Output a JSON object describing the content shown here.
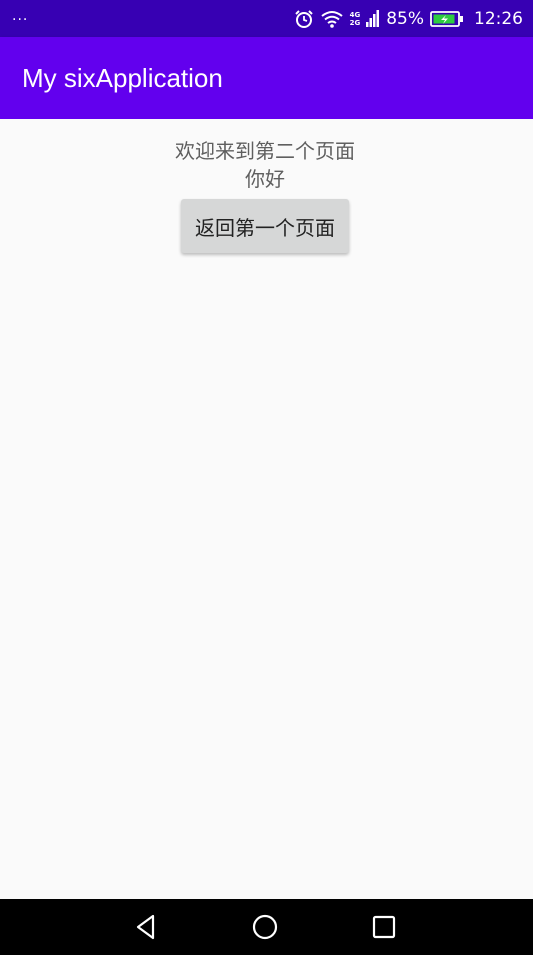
{
  "status_bar": {
    "left_text": "...",
    "network_top": "4G",
    "network_bottom": "2G",
    "battery_percent": "85%",
    "time": "12:26",
    "icons": [
      "alarm-icon",
      "wifi-icon",
      "signal-icon",
      "battery-charging-icon"
    ],
    "background": "#3700b3"
  },
  "app_bar": {
    "title": "My sixApplication",
    "background": "#6200ee"
  },
  "content": {
    "line1": "欢迎来到第二个页面",
    "line2": "你好",
    "back_button_label": "返回第一个页面"
  },
  "nav_bar": {
    "icons": [
      "back-triangle-icon",
      "home-circle-icon",
      "recents-square-icon"
    ]
  }
}
